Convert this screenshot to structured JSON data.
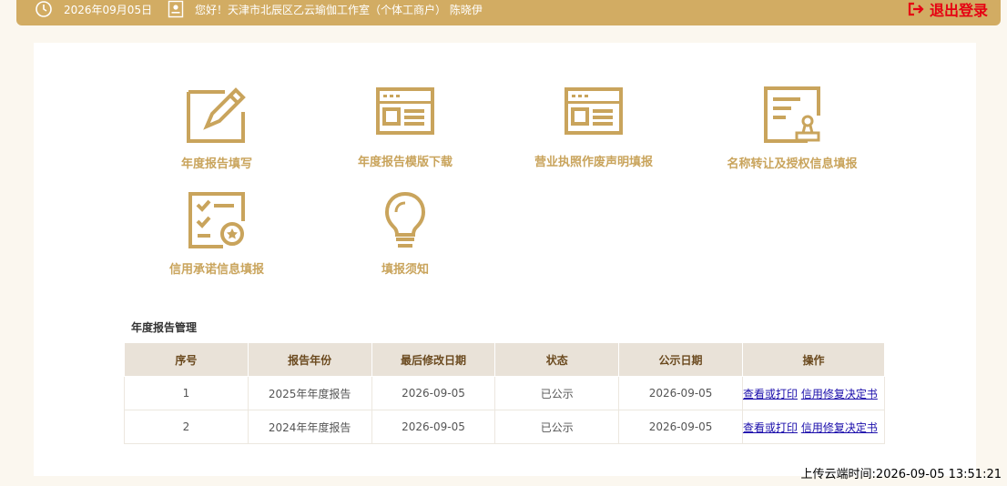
{
  "header": {
    "date": "2026年09月05日",
    "greeting": "您好！天津市北辰区乙云瑜伽工作室（个体工商户）  陈晓伊",
    "logout_label": "退出登录"
  },
  "menu": {
    "items": [
      {
        "label": "年度报告填写"
      },
      {
        "label": "年度报告模版下载"
      },
      {
        "label": "营业执照作废声明填报"
      },
      {
        "label": "名称转让及授权信息填报"
      },
      {
        "label": "信用承诺信息填报"
      },
      {
        "label": "填报须知"
      }
    ]
  },
  "report": {
    "title": "年度报告管理",
    "columns": [
      "序号",
      "报告年份",
      "最后修改日期",
      "状态",
      "公示日期",
      "操作"
    ],
    "rows": [
      {
        "no": "1",
        "year": "2025年年度报告",
        "modified": "2026-09-05",
        "status": "已公示",
        "published": "2026-09-05",
        "view": "查看或打印",
        "repair": "信用修复决定书"
      },
      {
        "no": "2",
        "year": "2024年年度报告",
        "modified": "2026-09-05",
        "status": "已公示",
        "published": "2026-09-05",
        "view": "查看或打印",
        "repair": "信用修复决定书"
      }
    ]
  },
  "footer": {
    "upload_time": "上传云端时间:2026-09-05 13:51:21"
  },
  "colors": {
    "accent": "#d2ac63",
    "icon": "#c9a45c",
    "logout": "#e60012"
  }
}
